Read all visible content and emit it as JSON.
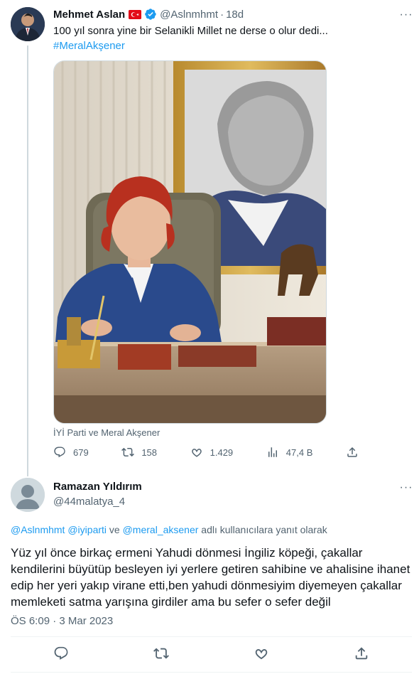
{
  "original_tweet": {
    "author_name": "Mehmet Aslan",
    "handle": "@Aslnmhmt",
    "separator": "·",
    "time": "18d",
    "text": "100 yıl sonra yine bir Selanikli Millet ne derse o olur dedi...",
    "hashtag": "#MeralAkşener",
    "media_caption": "İYİ Parti ve Meral Akşener",
    "stats": {
      "replies": "679",
      "retweets": "158",
      "likes": "1.429",
      "views": "47,4 B"
    },
    "more_label": "···",
    "icons": {
      "flag": "turkey-flag-icon",
      "verified": "verified-badge-icon"
    }
  },
  "reply_tweet": {
    "author_name": "Ramazan Yıldırım",
    "handle": "@44malatya_4",
    "more_label": "···",
    "reply_to": {
      "mention1": "@Aslnmhmt",
      "mention2": "@iyiparti",
      "connector": "ve",
      "mention3": "@meral_aksener",
      "suffix": "adlı kullanıcılara yanıt olarak"
    },
    "text": "Yüz yıl önce birkaç ermeni Yahudi dönmesi İngiliz köpeği, çakallar kendilerini büyütüp besleyen iyi yerlere getiren sahibine ve ahalisine ihanet edip her yeri yakıp virane etti,ben yahudi dönmesiyim diyemeyen çakallar memleketi satma yarışına girdiler ama bu sefer o sefer değil",
    "timestamp": "ÖS 6:09 · 3 Mar 2023"
  },
  "colors": {
    "accent": "#1d9bf0",
    "secondary_text": "#536471",
    "border": "#cfd9de"
  }
}
